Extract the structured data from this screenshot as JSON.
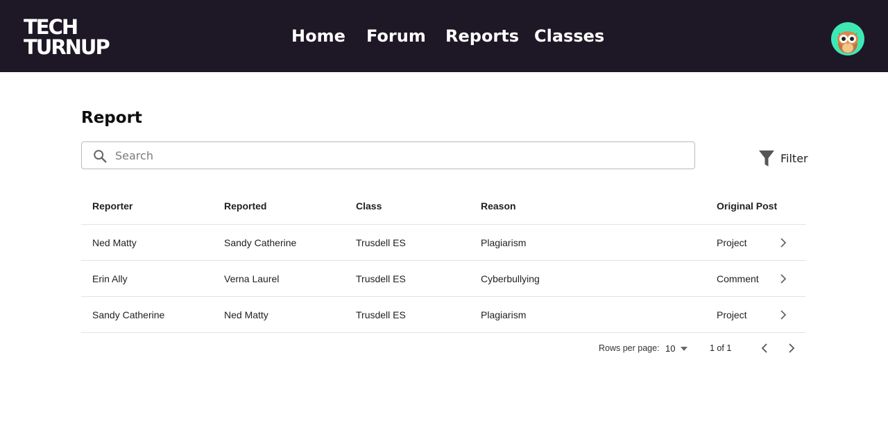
{
  "header": {
    "logo": {
      "line1": "TECH",
      "line2": "TURNUP"
    },
    "nav": [
      {
        "label": "Home"
      },
      {
        "label": "Forum"
      },
      {
        "label": "Reports"
      },
      {
        "label": "Classes"
      }
    ],
    "avatar_icon": "owl-avatar-icon"
  },
  "page": {
    "title": "Report"
  },
  "search": {
    "placeholder": "Search",
    "value": "",
    "icon": "search-icon"
  },
  "filter": {
    "label": "Filter",
    "icon": "funnel-icon"
  },
  "table": {
    "columns": [
      "Reporter",
      "Reported",
      "Class",
      "Reason",
      "Original Post"
    ],
    "rows": [
      [
        "Ned Matty",
        "Sandy Catherine",
        "Trusdell ES",
        "Plagiarism",
        "Project"
      ],
      [
        "Erin Ally",
        "Verna Laurel",
        "Trusdell ES",
        "Cyberbullying",
        "Comment"
      ],
      [
        "Sandy Catherine",
        "Ned Matty",
        "Trusdell ES",
        "Plagiarism",
        "Project"
      ]
    ]
  },
  "pagination": {
    "rows_per_page_label": "Rows per page:",
    "rows_per_page_value": "10",
    "page_info": "1 of 1"
  },
  "colors": {
    "header_bg": "#1e1826",
    "avatar_bg": "#3ee8b5",
    "owl_body": "#c8743a",
    "divider": "#e2e2e2"
  }
}
